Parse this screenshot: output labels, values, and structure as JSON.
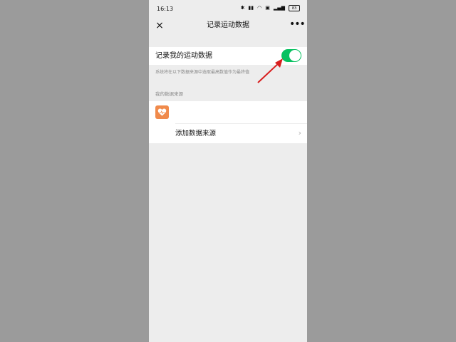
{
  "status_bar": {
    "time": "16:13",
    "icons": [
      "bluetooth-icon",
      "hd-icon",
      "wifi-icon",
      "data-icon",
      "signal-icon"
    ],
    "battery": "83"
  },
  "nav": {
    "title": "记录运动数据",
    "close_icon": "×",
    "more_icon": "•••"
  },
  "toggle": {
    "label": "记录我的运动数据",
    "state": "on",
    "on_color": "#07c160"
  },
  "hint": "系统将在以下数据来源中选取最高数值作为最终值",
  "section_header": "我的数据来源",
  "sources": {
    "items": [
      {
        "icon": "health-heart-icon",
        "color": "#f08a4b"
      }
    ],
    "add_label": "添加数据来源",
    "chevron": "›"
  },
  "annotation": {
    "arrow_color": "#d81e1e"
  }
}
